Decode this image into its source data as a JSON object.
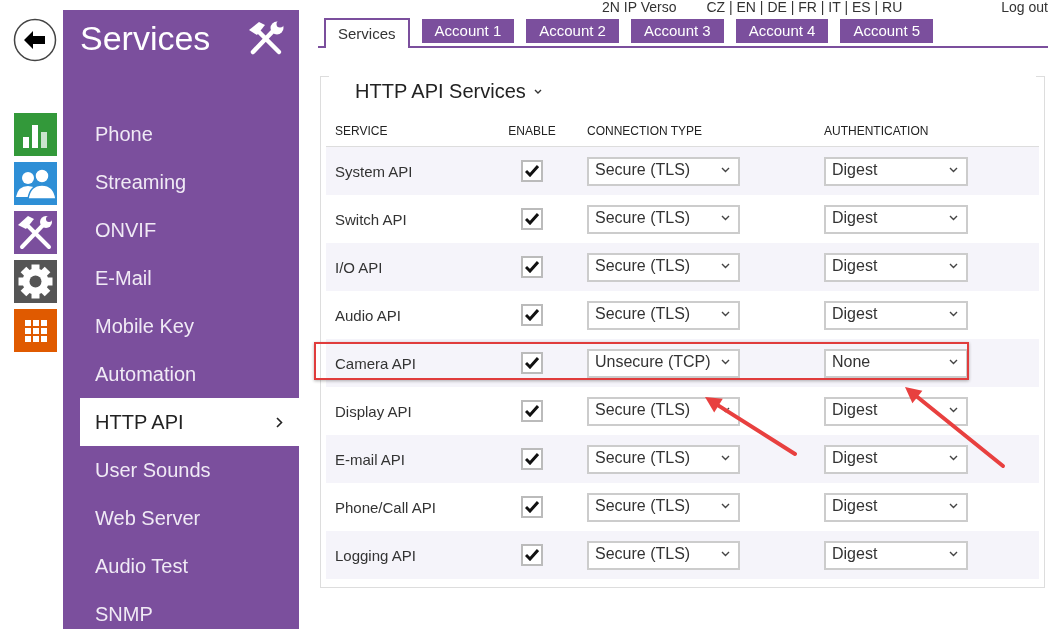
{
  "header": {
    "device": "2N IP Verso",
    "languages": "CZ | EN | DE | FR | IT | ES | RU",
    "logout": "Log out"
  },
  "app_menu": [
    {
      "kind": "back"
    },
    {
      "kind": "status"
    },
    {
      "kind": "directory"
    },
    {
      "kind": "services"
    },
    {
      "kind": "system"
    },
    {
      "kind": "hardware"
    }
  ],
  "sidebar": {
    "title": "Services",
    "items": [
      {
        "label": "Phone",
        "selected": false
      },
      {
        "label": "Streaming",
        "selected": false
      },
      {
        "label": "ONVIF",
        "selected": false
      },
      {
        "label": "E-Mail",
        "selected": false
      },
      {
        "label": "Mobile Key",
        "selected": false
      },
      {
        "label": "Automation",
        "selected": false
      },
      {
        "label": "HTTP API",
        "selected": true
      },
      {
        "label": "User Sounds",
        "selected": false
      },
      {
        "label": "Web Server",
        "selected": false
      },
      {
        "label": "Audio Test",
        "selected": false
      },
      {
        "label": "SNMP",
        "selected": false
      }
    ]
  },
  "tabs": [
    {
      "label": "Services",
      "selected": true
    },
    {
      "label": "Account 1",
      "selected": false
    },
    {
      "label": "Account 2",
      "selected": false
    },
    {
      "label": "Account 3",
      "selected": false
    },
    {
      "label": "Account 4",
      "selected": false
    },
    {
      "label": "Account 5",
      "selected": false
    }
  ],
  "section": {
    "title": "HTTP API Services",
    "expanded": true
  },
  "table": {
    "columns": [
      "SERVICE",
      "ENABLE",
      "CONNECTION TYPE",
      "AUTHENTICATION"
    ],
    "rows": [
      {
        "service": "System API",
        "enabled": true,
        "connection_type": "Secure (TLS)",
        "authentication": "Digest",
        "highlighted": false
      },
      {
        "service": "Switch API",
        "enabled": true,
        "connection_type": "Secure (TLS)",
        "authentication": "Digest",
        "highlighted": false
      },
      {
        "service": "I/O API",
        "enabled": true,
        "connection_type": "Secure (TLS)",
        "authentication": "Digest",
        "highlighted": false
      },
      {
        "service": "Audio API",
        "enabled": true,
        "connection_type": "Secure (TLS)",
        "authentication": "Digest",
        "highlighted": false
      },
      {
        "service": "Camera API",
        "enabled": true,
        "connection_type": "Unsecure (TCP)",
        "authentication": "None",
        "highlighted": true
      },
      {
        "service": "Display API",
        "enabled": true,
        "connection_type": "Secure (TLS)",
        "authentication": "Digest",
        "highlighted": false
      },
      {
        "service": "E-mail API",
        "enabled": true,
        "connection_type": "Secure (TLS)",
        "authentication": "Digest",
        "highlighted": false
      },
      {
        "service": "Phone/Call API",
        "enabled": true,
        "connection_type": "Secure (TLS)",
        "authentication": "Digest",
        "highlighted": false
      },
      {
        "service": "Logging API",
        "enabled": true,
        "connection_type": "Secure (TLS)",
        "authentication": "Digest",
        "highlighted": false
      }
    ]
  }
}
